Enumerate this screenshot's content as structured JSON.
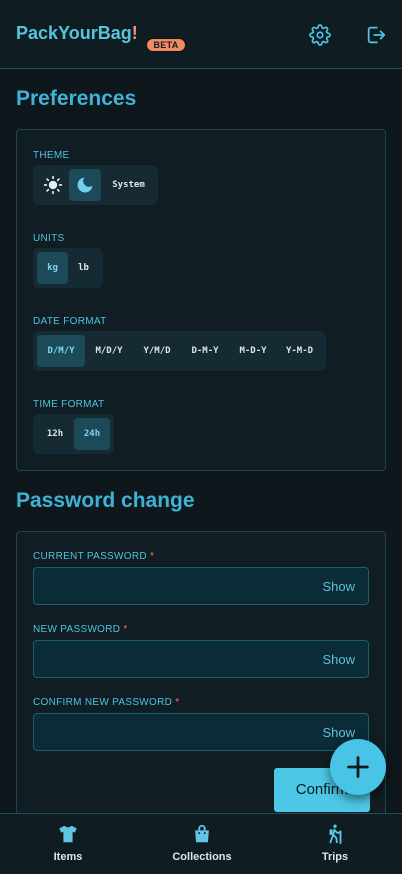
{
  "header": {
    "brand_main": "PackYourBag",
    "brand_accent": "!",
    "beta": "BETA",
    "icons": [
      "gear-icon",
      "logout-icon"
    ]
  },
  "preferences": {
    "title": "Preferences",
    "theme": {
      "label": "THEME",
      "options": [
        {
          "icon": "sun-icon",
          "selected": false
        },
        {
          "icon": "moon-icon",
          "selected": true
        },
        {
          "label": "System",
          "selected": false
        }
      ]
    },
    "units": {
      "label": "UNITS",
      "options": [
        {
          "label": "kg",
          "selected": true
        },
        {
          "label": "lb",
          "selected": false
        }
      ]
    },
    "date_format": {
      "label": "DATE FORMAT",
      "options": [
        {
          "label": "D/M/Y",
          "selected": true
        },
        {
          "label": "M/D/Y",
          "selected": false
        },
        {
          "label": "Y/M/D",
          "selected": false
        },
        {
          "label": "D-M-Y",
          "selected": false
        },
        {
          "label": "M-D-Y",
          "selected": false
        },
        {
          "label": "Y-M-D",
          "selected": false
        }
      ]
    },
    "time_format": {
      "label": "TIME FORMAT",
      "options": [
        {
          "label": "12h",
          "selected": false
        },
        {
          "label": "24h",
          "selected": true
        }
      ]
    }
  },
  "password": {
    "title": "Password change",
    "required_mark": "*",
    "show_label": "Show",
    "fields": [
      {
        "label": "CURRENT PASSWORD",
        "value": ""
      },
      {
        "label": "NEW PASSWORD",
        "value": ""
      },
      {
        "label": "CONFIRM NEW PASSWORD",
        "value": ""
      }
    ],
    "confirm_label": "Confirm"
  },
  "fab": {
    "icon": "plus-icon"
  },
  "bottom_nav": [
    {
      "label": "Items",
      "icon": "tshirt-icon"
    },
    {
      "label": "Collections",
      "icon": "bag-icon"
    },
    {
      "label": "Trips",
      "icon": "hiker-icon"
    }
  ],
  "colors": {
    "accent": "#4cc7e5",
    "brand_accent": "#e9997a",
    "beta_badge": "#ef8a63",
    "background": "#0d171c",
    "required": "#ff6b6b"
  }
}
